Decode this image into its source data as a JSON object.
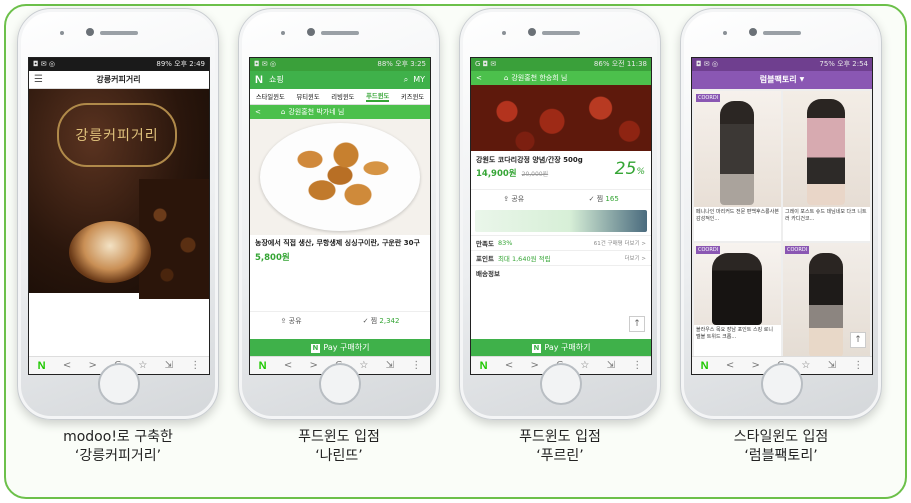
{
  "phones": [
    {
      "status_time": "오후 2:49",
      "battery": "89%",
      "appbar_title": "강릉커피거리",
      "logo_text": "강릉커피거리",
      "caption_line1": "modoo!로 구축한",
      "caption_line2": "‘강릉커피거리’"
    },
    {
      "status_time": "오후 3:25",
      "battery": "88%",
      "header_logo": "N",
      "header_title": "쇼핑",
      "header_my": "MY",
      "tabs": [
        "스타일윈도",
        "뷰티윈도",
        "리빙윈도",
        "푸드윈도",
        "키즈윈도"
      ],
      "store_bar": "강원홍천 박가네 님",
      "product_title": "농장에서 직접 생산, 무항생제 싱싱구이란, 구운란 30구",
      "price": "5,800원",
      "share_label": "공유",
      "like_label": "찜",
      "like_count": "2,342",
      "pay_label": "Pay 구매하기",
      "caption_line1": "푸드윈도 입점",
      "caption_line2": "‘나린뜨’"
    },
    {
      "status_time": "오전 11:38",
      "battery": "86%",
      "store_bar": "강원홍천 한승희 님",
      "product_title": "강원도 코다리강정 양념/간장 500g",
      "price": "14,900원",
      "original_price": "20,000원",
      "discount": "25",
      "discount_unit": "%",
      "share_label": "공유",
      "like_label": "찜",
      "like_count": "165",
      "satisfaction_label": "만족도",
      "satisfaction_value": "83%",
      "review_text": "61건 구매평 더보기 >",
      "point_label": "포인트",
      "point_value": "최대 1,640원 적립",
      "point_more": "더보기 >",
      "shipping_label": "배송정보",
      "pay_label": "Pay 구매하기",
      "caption_line1": "푸드윈도 입점",
      "caption_line2": "‘푸르린’"
    },
    {
      "status_time": "오후 2:54",
      "battery": "75%",
      "appbar_title": "럼블팩토리",
      "tag": "COORDI",
      "item1_text": "페니나인 마리커드 전문 편백후스롱사본 감성적인...",
      "item2_text": "그레이 포스트 슈드 데님네모 다크 니트러 카디건코...",
      "item3_text": "블라우스 목요 장남 포인트 스킹 로니 멜블 트위드 크롭...",
      "caption_line1": "스타일윈도 입점",
      "caption_line2": "‘럼블팩토리’"
    }
  ],
  "navbar": {
    "logo": "N",
    "back": "<",
    "forward": ">",
    "reload": "C",
    "star": "☆",
    "share": "⇲",
    "more": "⋮"
  },
  "colors": {
    "frame": "#6cc04a",
    "naver_green": "#1ec800",
    "pay_green": "#3fb14a",
    "purple": "#8a57b3"
  }
}
